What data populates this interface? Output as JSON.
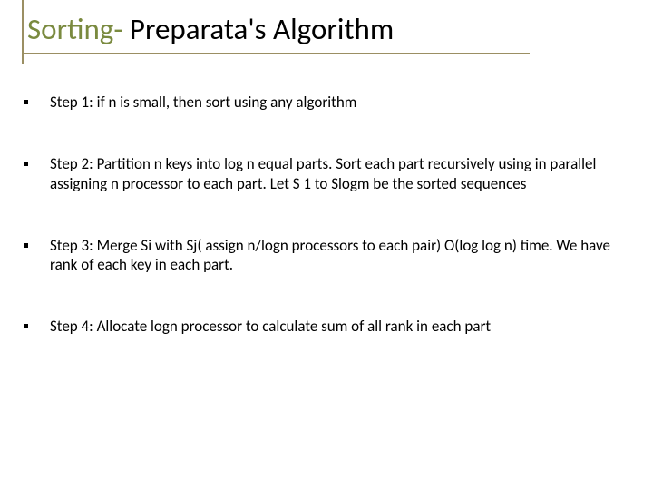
{
  "title": {
    "accent": "Sorting-",
    "rest": " Preparata's Algorithm"
  },
  "items": [
    {
      "text": "Step 1:  if n is small, then sort using any algorithm"
    },
    {
      "text": "Step 2:  Partition n keys into log n equal parts. Sort each part recursively using in parallel assigning n processor to each part. Let S 1 to Slogm be the sorted sequences"
    },
    {
      "text": "Step 3: Merge Si with Sj( assign n/logn processors to each pair) O(log log n) time. We have rank of each key in each part."
    },
    {
      "text": "Step 4: Allocate logn processor to calculate sum of all rank in each part"
    }
  ]
}
